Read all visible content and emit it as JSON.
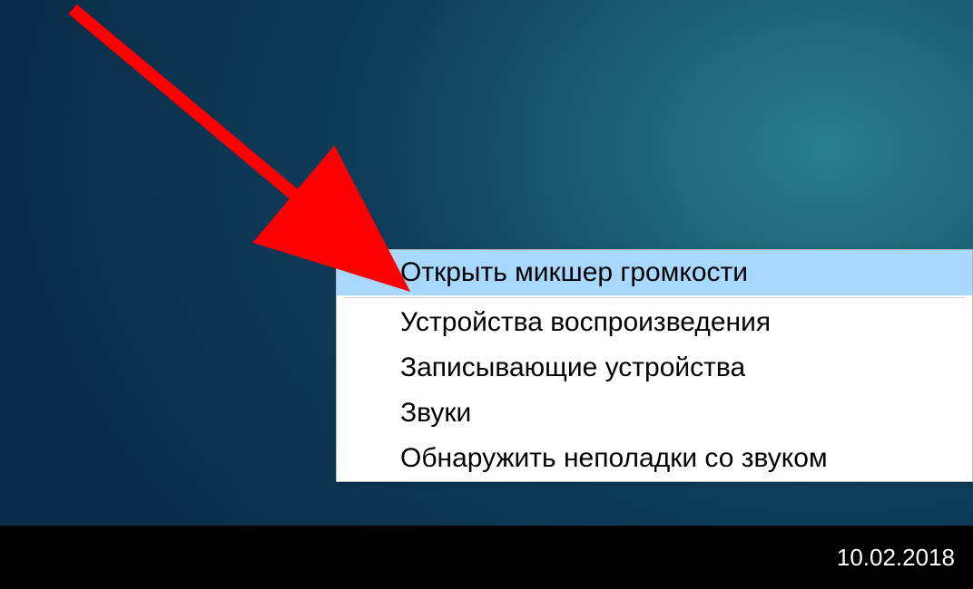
{
  "taskbar": {
    "date": "10.02.2018"
  },
  "context_menu": {
    "items": [
      {
        "label": "Открыть микшер громкости",
        "highlighted": true
      },
      {
        "label": "Устройства воспроизведения",
        "highlighted": false
      },
      {
        "label": "Записывающие устройства",
        "highlighted": false
      },
      {
        "label": "Звуки",
        "highlighted": false
      },
      {
        "label": "Обнаружить неполадки со звуком",
        "highlighted": false
      }
    ]
  },
  "annotation": {
    "arrow_color": "#ff0000"
  }
}
